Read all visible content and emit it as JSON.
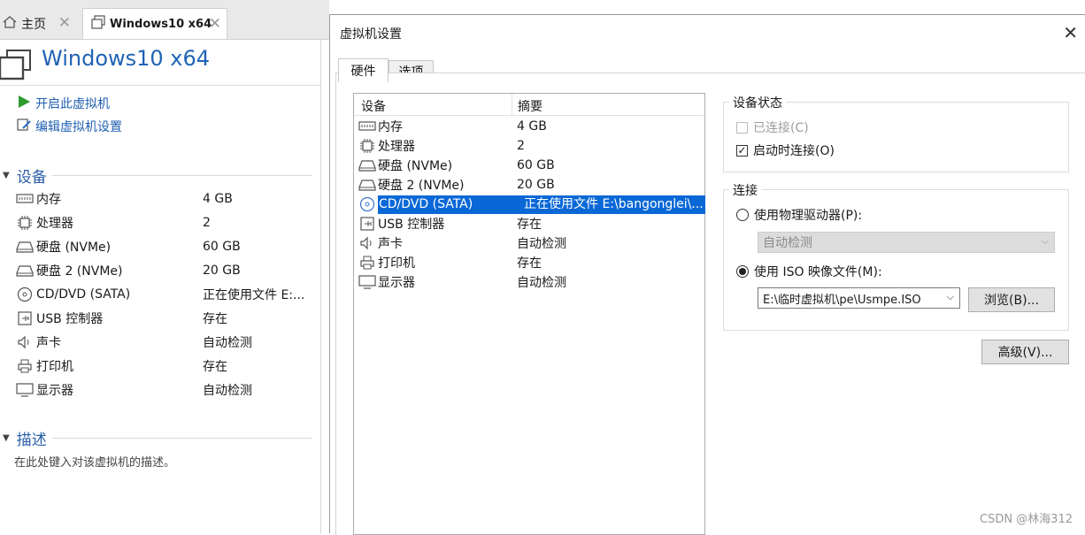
{
  "host": {
    "tabs": [
      {
        "label": "主页",
        "icon": "home-icon"
      },
      {
        "label": "Windows10 x64",
        "icon": "vm-icon"
      }
    ],
    "title": "Windows10 x64",
    "actions": {
      "power_on": "开启此虚拟机",
      "edit_settings": "编辑虚拟机设置"
    },
    "devices_header": "设备",
    "devices": [
      {
        "name": "内存",
        "value": "4 GB",
        "icon": "memory-icon"
      },
      {
        "name": "处理器",
        "value": "2",
        "icon": "cpu-icon"
      },
      {
        "name": "硬盘 (NVMe)",
        "value": "60 GB",
        "icon": "hard-disk-icon"
      },
      {
        "name": "硬盘 2 (NVMe)",
        "value": "20 GB",
        "icon": "hard-disk-icon"
      },
      {
        "name": "CD/DVD (SATA)",
        "value": "正在使用文件 E:...",
        "icon": "cd-dvd-icon"
      },
      {
        "name": "USB 控制器",
        "value": "存在",
        "icon": "usb-icon"
      },
      {
        "name": "声卡",
        "value": "自动检测",
        "icon": "speaker-icon"
      },
      {
        "name": "打印机",
        "value": "存在",
        "icon": "printer-icon"
      },
      {
        "name": "显示器",
        "value": "自动检测",
        "icon": "display-icon"
      }
    ],
    "description_header": "描述",
    "description_placeholder": "在此处键入对该虚拟机的描述。"
  },
  "dialog": {
    "title": "虚拟机设置",
    "tabs": [
      {
        "label": "硬件"
      },
      {
        "label": "选项"
      }
    ],
    "list": {
      "col_device": "设备",
      "col_summary": "摘要",
      "rows": [
        {
          "name": "内存",
          "value": "4 GB",
          "icon": "memory-icon"
        },
        {
          "name": "处理器",
          "value": "2",
          "icon": "cpu-icon"
        },
        {
          "name": "硬盘 (NVMe)",
          "value": "60 GB",
          "icon": "hard-disk-icon"
        },
        {
          "name": "硬盘 2 (NVMe)",
          "value": "20 GB",
          "icon": "hard-disk-icon"
        },
        {
          "name": "CD/DVD (SATA)",
          "value": "正在使用文件 E:\\bangonglei\\...",
          "icon": "cd-dvd-icon",
          "selected": true
        },
        {
          "name": "USB 控制器",
          "value": "存在",
          "icon": "usb-icon"
        },
        {
          "name": "声卡",
          "value": "自动检测",
          "icon": "speaker-icon"
        },
        {
          "name": "打印机",
          "value": "存在",
          "icon": "printer-icon"
        },
        {
          "name": "显示器",
          "value": "自动检测",
          "icon": "display-icon"
        }
      ]
    },
    "device_status": {
      "title": "设备状态",
      "connected": {
        "label": "已连接(C)",
        "checked": false,
        "disabled": true
      },
      "connect_at_power_on": {
        "label": "启动时连接(O)",
        "checked": true
      }
    },
    "connection": {
      "title": "连接",
      "physical_drive": {
        "label": "使用物理驱动器(P):",
        "selected": false
      },
      "physical_drive_select": "自动检测",
      "iso_file": {
        "label": "使用 ISO 映像文件(M):",
        "selected": true
      },
      "iso_path": "E:\\临时虚拟机\\pe\\Usmpe.ISO",
      "browse_button": "浏览(B)..."
    },
    "advanced_button": "高级(V)..."
  },
  "watermark": "CSDN @林海312",
  "colors": {
    "accent": "#0a68d6",
    "title_blue": "#1f63b5",
    "power_green": "#2e9b2e"
  }
}
